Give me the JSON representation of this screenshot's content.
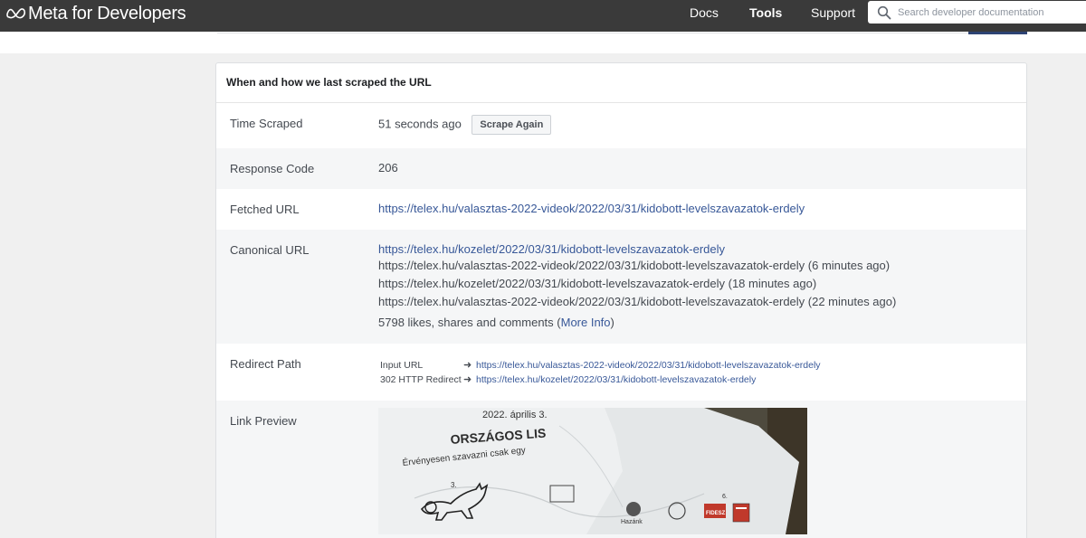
{
  "nav": {
    "brand": "Meta for Developers",
    "links": [
      "Docs",
      "Tools",
      "Support"
    ],
    "search_placeholder": "Search developer documentation"
  },
  "card": {
    "title": "When and how we last scraped the URL",
    "time_scraped": {
      "label": "Time Scraped",
      "value": "51 seconds ago",
      "button": "Scrape Again"
    },
    "response_code": {
      "label": "Response Code",
      "value": "206"
    },
    "fetched_url": {
      "label": "Fetched URL",
      "value": "https://telex.hu/valasztas-2022-videok/2022/03/31/kidobott-levelszavazatok-erdely"
    },
    "canonical_url": {
      "label": "Canonical URL",
      "primary": "https://telex.hu/kozelet/2022/03/31/kidobott-levelszavazatok-erdely",
      "history": [
        "https://telex.hu/valasztas-2022-videok/2022/03/31/kidobott-levelszavazatok-erdely (6 minutes ago)",
        "https://telex.hu/kozelet/2022/03/31/kidobott-levelszavazatok-erdely (18 minutes ago)",
        "https://telex.hu/valasztas-2022-videok/2022/03/31/kidobott-levelszavazatok-erdely (22 minutes ago)"
      ],
      "likes_text": "5798 likes, shares and comments (",
      "more_info": "More Info",
      "likes_close": ")"
    },
    "redirect_path": {
      "label": "Redirect Path",
      "steps": [
        {
          "kind": "Input URL",
          "url": "https://telex.hu/valasztas-2022-videok/2022/03/31/kidobott-levelszavazatok-erdely"
        },
        {
          "kind": "302 HTTP Redirect",
          "url": "https://telex.hu/kozelet/2022/03/31/kidobott-levelszavazatok-erdely"
        }
      ]
    },
    "link_preview": {
      "label": "Link Preview",
      "image_text": [
        "2022. április 3.",
        "ORSZÁGOS LIS",
        "Érvényesen szavazni csak egy",
        "FIDESZ"
      ]
    }
  }
}
